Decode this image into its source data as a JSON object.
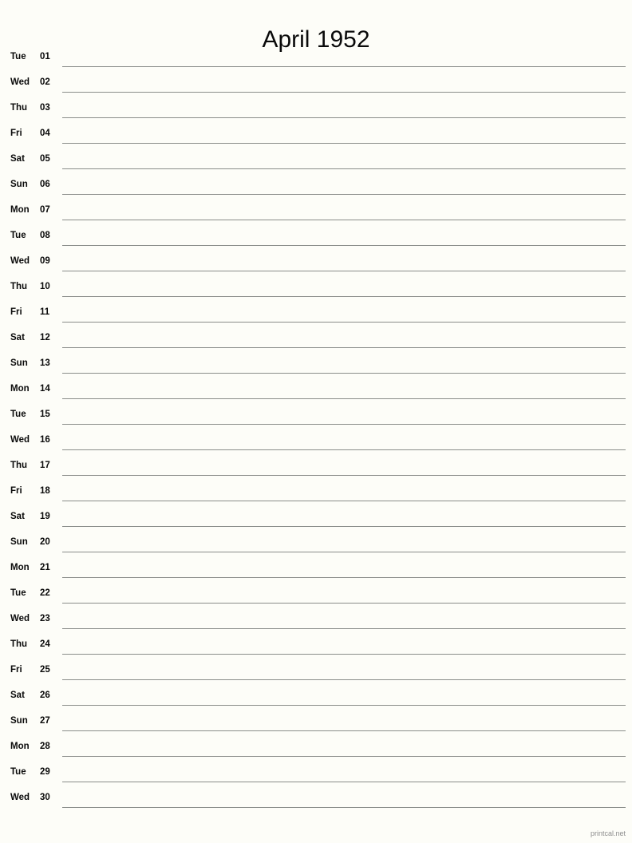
{
  "header": {
    "title": "April 1952"
  },
  "footer": {
    "credit": "printcal.net"
  },
  "colors": {
    "page_background": "#fdfdf8",
    "text": "#0a0a0a",
    "rule_line": "#8a8d8a",
    "footer_text": "#8f8f8f"
  },
  "calendar": {
    "month_name": "April",
    "year": "1952",
    "layout": "notepad-lined-list",
    "day_count": 30,
    "days": [
      {
        "weekday": "Tue",
        "date": "01"
      },
      {
        "weekday": "Wed",
        "date": "02"
      },
      {
        "weekday": "Thu",
        "date": "03"
      },
      {
        "weekday": "Fri",
        "date": "04"
      },
      {
        "weekday": "Sat",
        "date": "05"
      },
      {
        "weekday": "Sun",
        "date": "06"
      },
      {
        "weekday": "Mon",
        "date": "07"
      },
      {
        "weekday": "Tue",
        "date": "08"
      },
      {
        "weekday": "Wed",
        "date": "09"
      },
      {
        "weekday": "Thu",
        "date": "10"
      },
      {
        "weekday": "Fri",
        "date": "11"
      },
      {
        "weekday": "Sat",
        "date": "12"
      },
      {
        "weekday": "Sun",
        "date": "13"
      },
      {
        "weekday": "Mon",
        "date": "14"
      },
      {
        "weekday": "Tue",
        "date": "15"
      },
      {
        "weekday": "Wed",
        "date": "16"
      },
      {
        "weekday": "Thu",
        "date": "17"
      },
      {
        "weekday": "Fri",
        "date": "18"
      },
      {
        "weekday": "Sat",
        "date": "19"
      },
      {
        "weekday": "Sun",
        "date": "20"
      },
      {
        "weekday": "Mon",
        "date": "21"
      },
      {
        "weekday": "Tue",
        "date": "22"
      },
      {
        "weekday": "Wed",
        "date": "23"
      },
      {
        "weekday": "Thu",
        "date": "24"
      },
      {
        "weekday": "Fri",
        "date": "25"
      },
      {
        "weekday": "Sat",
        "date": "26"
      },
      {
        "weekday": "Sun",
        "date": "27"
      },
      {
        "weekday": "Mon",
        "date": "28"
      },
      {
        "weekday": "Tue",
        "date": "29"
      },
      {
        "weekday": "Wed",
        "date": "30"
      }
    ]
  }
}
